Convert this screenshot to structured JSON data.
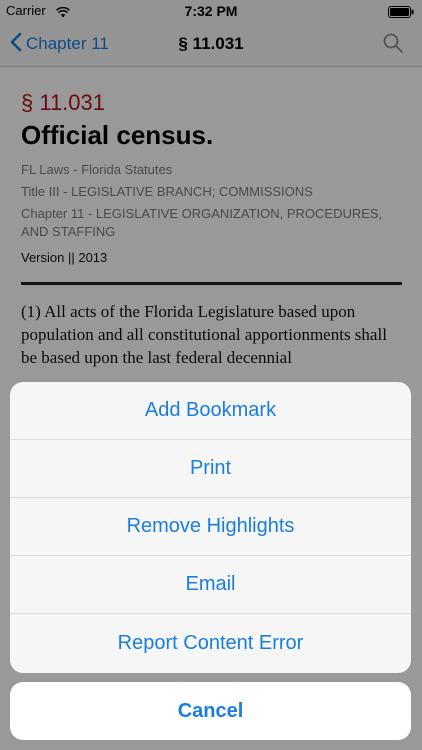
{
  "status_bar": {
    "carrier": "Carrier",
    "time": "7:32 PM"
  },
  "nav": {
    "back_label": "Chapter 11",
    "title": "§ 11.031"
  },
  "section": {
    "number": "§ 11.031",
    "title": "Official census.",
    "meta": [
      "FL Laws - Florida Statutes",
      "Title III - LEGISLATIVE BRANCH; COMMISSIONS",
      "Chapter 11 - LEGISLATIVE ORGANIZATION, PROCEDURES, AND STAFFING"
    ],
    "version": "Version || 2013",
    "body": "(1)    All acts of the Florida Legislature based upon population and all constitutional apportionments shall be based upon the last federal decennial"
  },
  "action_sheet": {
    "items": [
      "Add Bookmark",
      "Print",
      "Remove Highlights",
      "Email",
      "Report Content Error"
    ],
    "cancel": "Cancel"
  },
  "colors": {
    "accent": "#1a7ee0",
    "section_number": "#b01616"
  }
}
